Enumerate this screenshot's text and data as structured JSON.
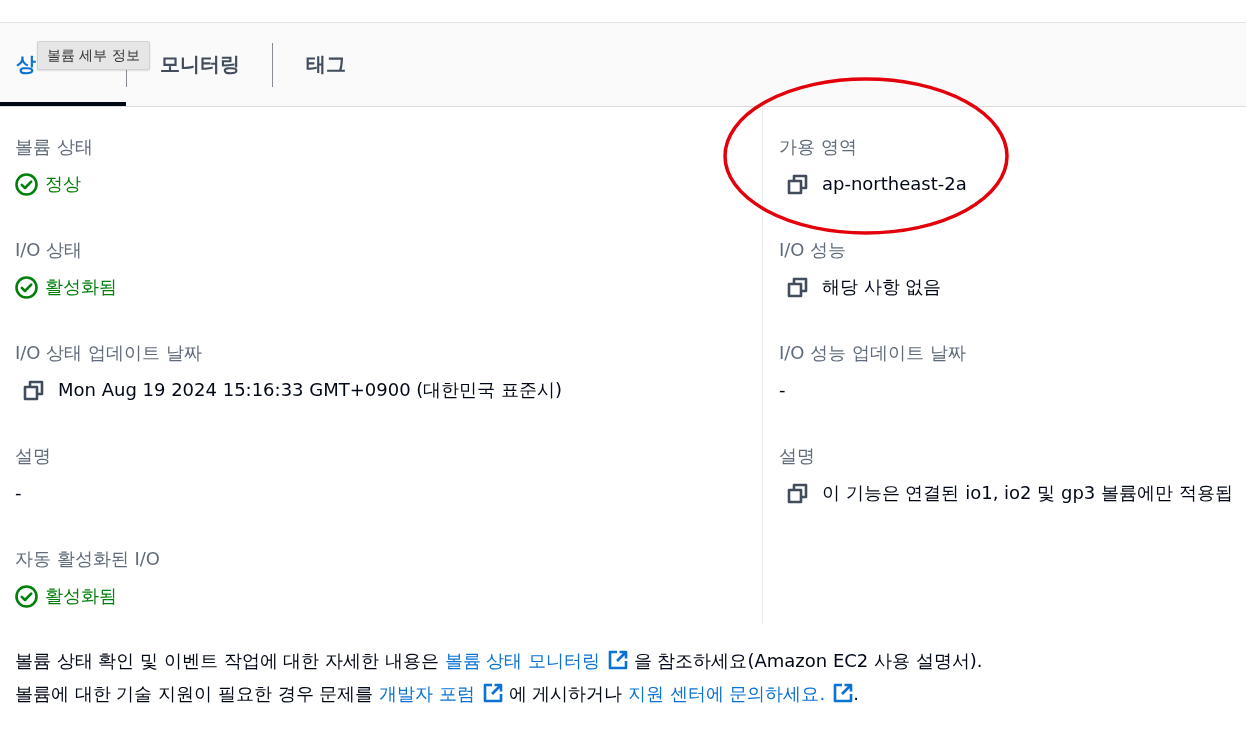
{
  "tooltip": {
    "text": "볼륨 세부 정보"
  },
  "tabs": [
    {
      "label": "상",
      "selected": true
    },
    {
      "label": "모니터링",
      "selected": false
    },
    {
      "label": "태그",
      "selected": false
    }
  ],
  "columns": [
    [
      {
        "label": "볼륨 상태",
        "kind": "status",
        "value": "정상",
        "circled": false
      },
      {
        "label": "I/O 상태",
        "kind": "status",
        "value": "활성화됨",
        "circled": false
      },
      {
        "label": "I/O 상태 업데이트 날짜",
        "kind": "copyable",
        "value": "Mon Aug 19 2024 15:16:33 GMT+0900 (대한민국 표준시)",
        "circled": false
      },
      {
        "label": "설명",
        "kind": "plain",
        "value": "-",
        "circled": false
      },
      {
        "label": "자동 활성화된 I/O",
        "kind": "status",
        "value": "활성화됨",
        "circled": false
      }
    ],
    [
      {
        "label": "가용 영역",
        "kind": "copyable",
        "value": "ap-northeast-2a",
        "circled": true
      },
      {
        "label": "I/O 성능",
        "kind": "copyable",
        "value": "해당 사항 없음",
        "circled": false
      },
      {
        "label": "I/O 성능 업데이트 날짜",
        "kind": "plain",
        "value": "-",
        "circled": false
      },
      {
        "label": "설명",
        "kind": "copyable",
        "value": "이 기능은 연결된 io1, io2 및 gp3 볼륨에만 적용됩",
        "circled": false
      }
    ]
  ],
  "footer": [
    [
      {
        "kind": "text",
        "text": "볼륨 상태 확인 및 이벤트 작업에 대한 자세한 내용은 "
      },
      {
        "kind": "link",
        "text": "볼륨 상태 모니터링",
        "external": true
      },
      {
        "kind": "text",
        "text": " 을 참조하세요(Amazon EC2 사용 설명서)."
      }
    ],
    [
      {
        "kind": "text",
        "text": "볼륨에 대한 기술 지원이 필요한 경우 문제를 "
      },
      {
        "kind": "link",
        "text": "개발자 포럼",
        "external": true
      },
      {
        "kind": "text",
        "text": " 에 게시하거나 "
      },
      {
        "kind": "link",
        "text": "지원 센터에 문의하세요.",
        "external": true
      },
      {
        "kind": "text",
        "text": "."
      }
    ]
  ]
}
